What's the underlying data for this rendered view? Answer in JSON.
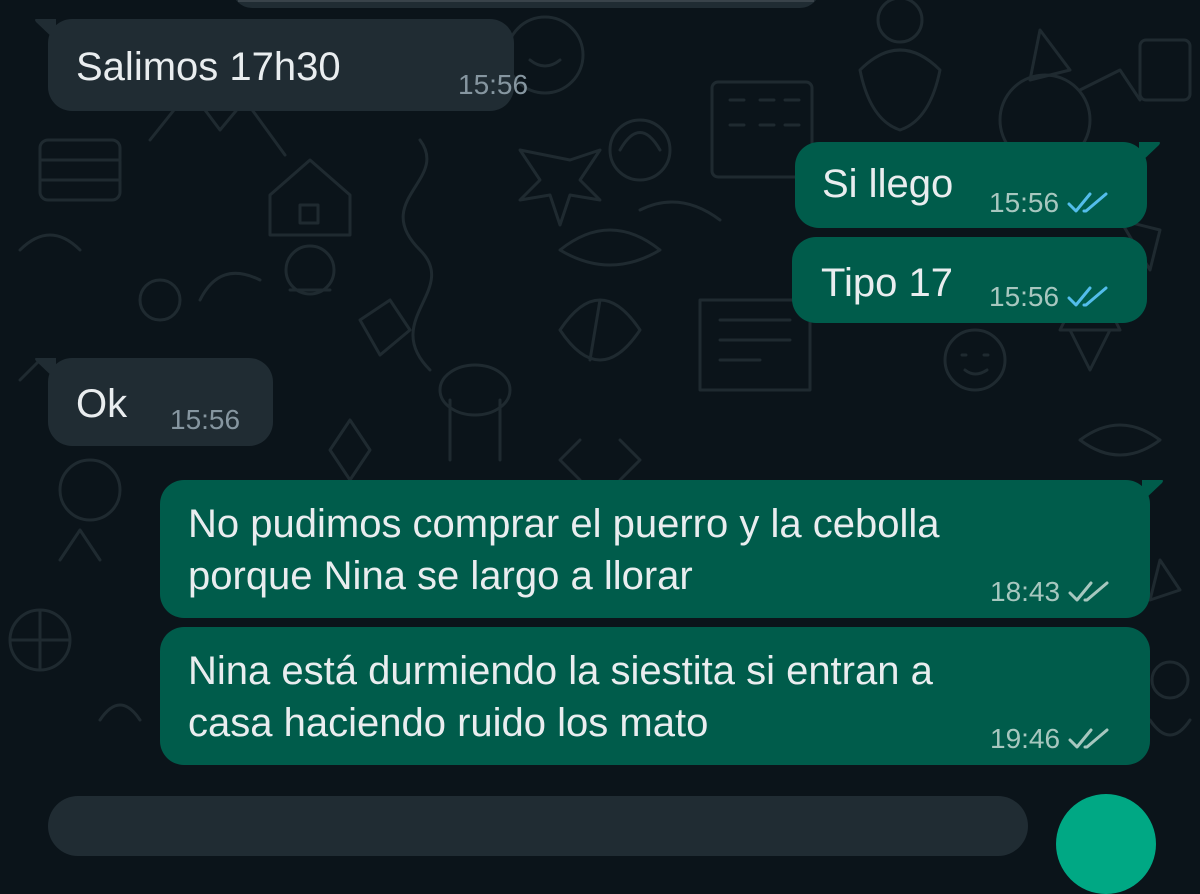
{
  "chat": {
    "messages": [
      {
        "direction": "incoming",
        "text": "Salimos 17h30",
        "time": "15:56"
      },
      {
        "direction": "outgoing",
        "text": "Si llego",
        "time": "15:56",
        "status_icon": "double-check-read-icon",
        "status_color": "#53bdeb"
      },
      {
        "direction": "outgoing",
        "text": "Tipo 17",
        "time": "15:56",
        "status_icon": "double-check-read-icon",
        "status_color": "#53bdeb"
      },
      {
        "direction": "incoming",
        "text": "Ok",
        "time": "15:56"
      },
      {
        "direction": "outgoing",
        "text": "No pudimos comprar el puerro y la cebolla\nporque Nina se largo a llorar",
        "time": "18:43",
        "status_icon": "double-check-delivered-icon",
        "status_color": "#a7c7bf"
      },
      {
        "direction": "outgoing",
        "text": "Nina está durmiendo la siestita si entran a\ncasa haciendo ruido los mato",
        "time": "19:46",
        "status_icon": "double-check-delivered-icon",
        "status_color": "#a7c7bf"
      }
    ]
  },
  "theme": {
    "background": "#0b141a",
    "incoming_bubble": "#202c33",
    "outgoing_bubble": "#005c4b",
    "accent": "#00a884"
  }
}
